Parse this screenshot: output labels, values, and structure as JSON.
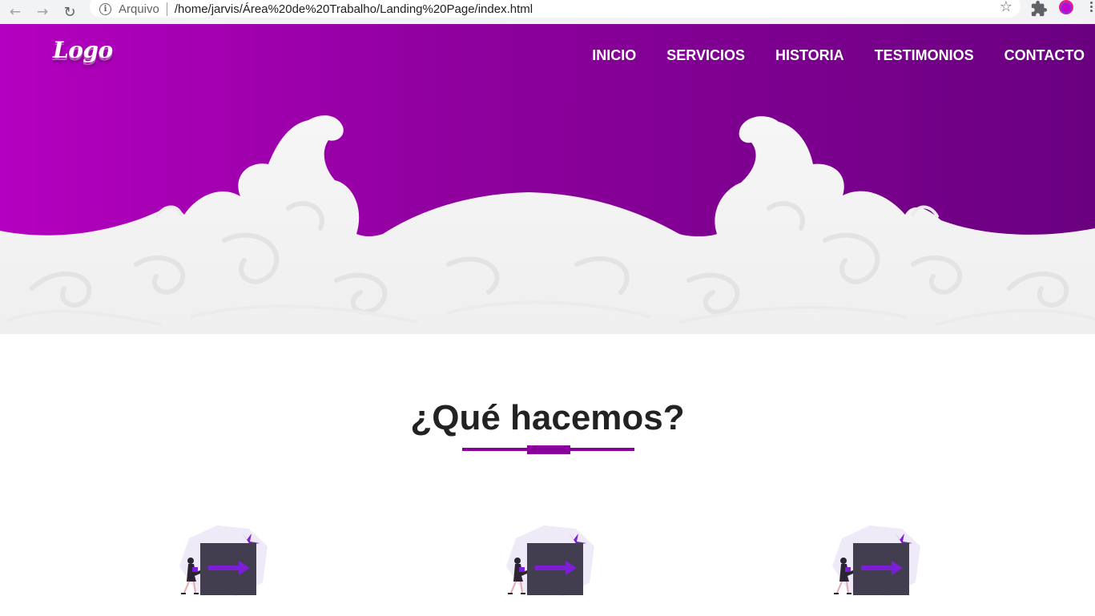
{
  "browser": {
    "address_label": "Arquivo",
    "url": "/home/jarvis/Área%20de%20Trabalho/Landing%20Page/index.html",
    "icons": [
      "back-arrow-icon",
      "forward-arrow-icon",
      "reload-icon",
      "info-icon",
      "star-icon",
      "extensions-icon",
      "profile-icon",
      "menu-icon"
    ]
  },
  "header": {
    "logo": "Logo",
    "nav": [
      "INICIO",
      "SERVICIOS",
      "HISTORIA",
      "TESTIMONIOS",
      "CONTACTO"
    ]
  },
  "services": {
    "title": "¿Qué hacemos?",
    "cards": [
      {
        "illustration": "person-pushing-box-illustration"
      },
      {
        "illustration": "person-pushing-box-illustration"
      },
      {
        "illustration": "person-pushing-box-illustration"
      }
    ]
  },
  "colors": {
    "gradient_start": "#b400c0",
    "gradient_end": "#6a0080",
    "accent": "#8a009a",
    "waves": "#f5f5f5"
  }
}
